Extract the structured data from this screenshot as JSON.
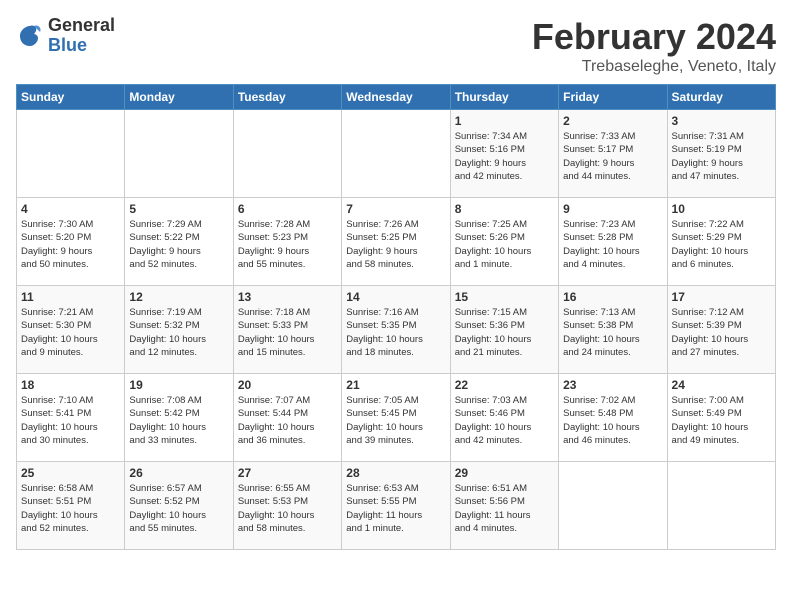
{
  "header": {
    "logo_general": "General",
    "logo_blue": "Blue",
    "month_title": "February 2024",
    "location": "Trebaseleghe, Veneto, Italy"
  },
  "days_of_week": [
    "Sunday",
    "Monday",
    "Tuesday",
    "Wednesday",
    "Thursday",
    "Friday",
    "Saturday"
  ],
  "weeks": [
    [
      {
        "day": "",
        "info": ""
      },
      {
        "day": "",
        "info": ""
      },
      {
        "day": "",
        "info": ""
      },
      {
        "day": "",
        "info": ""
      },
      {
        "day": "1",
        "info": "Sunrise: 7:34 AM\nSunset: 5:16 PM\nDaylight: 9 hours\nand 42 minutes."
      },
      {
        "day": "2",
        "info": "Sunrise: 7:33 AM\nSunset: 5:17 PM\nDaylight: 9 hours\nand 44 minutes."
      },
      {
        "day": "3",
        "info": "Sunrise: 7:31 AM\nSunset: 5:19 PM\nDaylight: 9 hours\nand 47 minutes."
      }
    ],
    [
      {
        "day": "4",
        "info": "Sunrise: 7:30 AM\nSunset: 5:20 PM\nDaylight: 9 hours\nand 50 minutes."
      },
      {
        "day": "5",
        "info": "Sunrise: 7:29 AM\nSunset: 5:22 PM\nDaylight: 9 hours\nand 52 minutes."
      },
      {
        "day": "6",
        "info": "Sunrise: 7:28 AM\nSunset: 5:23 PM\nDaylight: 9 hours\nand 55 minutes."
      },
      {
        "day": "7",
        "info": "Sunrise: 7:26 AM\nSunset: 5:25 PM\nDaylight: 9 hours\nand 58 minutes."
      },
      {
        "day": "8",
        "info": "Sunrise: 7:25 AM\nSunset: 5:26 PM\nDaylight: 10 hours\nand 1 minute."
      },
      {
        "day": "9",
        "info": "Sunrise: 7:23 AM\nSunset: 5:28 PM\nDaylight: 10 hours\nand 4 minutes."
      },
      {
        "day": "10",
        "info": "Sunrise: 7:22 AM\nSunset: 5:29 PM\nDaylight: 10 hours\nand 6 minutes."
      }
    ],
    [
      {
        "day": "11",
        "info": "Sunrise: 7:21 AM\nSunset: 5:30 PM\nDaylight: 10 hours\nand 9 minutes."
      },
      {
        "day": "12",
        "info": "Sunrise: 7:19 AM\nSunset: 5:32 PM\nDaylight: 10 hours\nand 12 minutes."
      },
      {
        "day": "13",
        "info": "Sunrise: 7:18 AM\nSunset: 5:33 PM\nDaylight: 10 hours\nand 15 minutes."
      },
      {
        "day": "14",
        "info": "Sunrise: 7:16 AM\nSunset: 5:35 PM\nDaylight: 10 hours\nand 18 minutes."
      },
      {
        "day": "15",
        "info": "Sunrise: 7:15 AM\nSunset: 5:36 PM\nDaylight: 10 hours\nand 21 minutes."
      },
      {
        "day": "16",
        "info": "Sunrise: 7:13 AM\nSunset: 5:38 PM\nDaylight: 10 hours\nand 24 minutes."
      },
      {
        "day": "17",
        "info": "Sunrise: 7:12 AM\nSunset: 5:39 PM\nDaylight: 10 hours\nand 27 minutes."
      }
    ],
    [
      {
        "day": "18",
        "info": "Sunrise: 7:10 AM\nSunset: 5:41 PM\nDaylight: 10 hours\nand 30 minutes."
      },
      {
        "day": "19",
        "info": "Sunrise: 7:08 AM\nSunset: 5:42 PM\nDaylight: 10 hours\nand 33 minutes."
      },
      {
        "day": "20",
        "info": "Sunrise: 7:07 AM\nSunset: 5:44 PM\nDaylight: 10 hours\nand 36 minutes."
      },
      {
        "day": "21",
        "info": "Sunrise: 7:05 AM\nSunset: 5:45 PM\nDaylight: 10 hours\nand 39 minutes."
      },
      {
        "day": "22",
        "info": "Sunrise: 7:03 AM\nSunset: 5:46 PM\nDaylight: 10 hours\nand 42 minutes."
      },
      {
        "day": "23",
        "info": "Sunrise: 7:02 AM\nSunset: 5:48 PM\nDaylight: 10 hours\nand 46 minutes."
      },
      {
        "day": "24",
        "info": "Sunrise: 7:00 AM\nSunset: 5:49 PM\nDaylight: 10 hours\nand 49 minutes."
      }
    ],
    [
      {
        "day": "25",
        "info": "Sunrise: 6:58 AM\nSunset: 5:51 PM\nDaylight: 10 hours\nand 52 minutes."
      },
      {
        "day": "26",
        "info": "Sunrise: 6:57 AM\nSunset: 5:52 PM\nDaylight: 10 hours\nand 55 minutes."
      },
      {
        "day": "27",
        "info": "Sunrise: 6:55 AM\nSunset: 5:53 PM\nDaylight: 10 hours\nand 58 minutes."
      },
      {
        "day": "28",
        "info": "Sunrise: 6:53 AM\nSunset: 5:55 PM\nDaylight: 11 hours\nand 1 minute."
      },
      {
        "day": "29",
        "info": "Sunrise: 6:51 AM\nSunset: 5:56 PM\nDaylight: 11 hours\nand 4 minutes."
      },
      {
        "day": "",
        "info": ""
      },
      {
        "day": "",
        "info": ""
      }
    ]
  ]
}
